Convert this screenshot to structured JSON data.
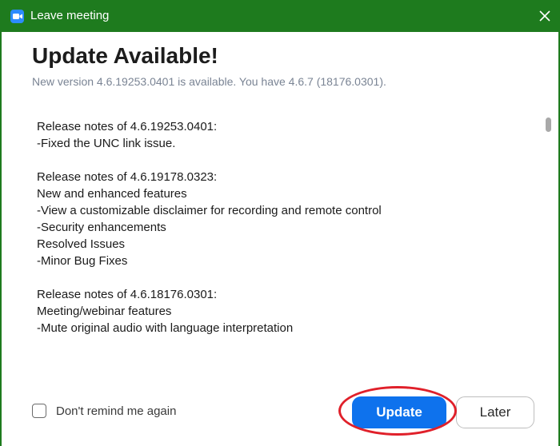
{
  "window": {
    "title": "Leave meeting",
    "title_bar_color": "#1e7b1e",
    "app_icon": "zoom-camera-icon",
    "close_icon": "close-icon"
  },
  "dialog": {
    "heading": "Update Available!",
    "version_info": "New version 4.6.19253.0401 is available. You have 4.6.7 (18176.0301)."
  },
  "release_notes": [
    "Release notes of 4.6.19253.0401:",
    "-Fixed the UNC link issue.",
    "",
    "Release notes of 4.6.19178.0323:",
    "New and enhanced features",
    "-View a customizable disclaimer for recording and remote control",
    "-Security enhancements",
    "Resolved Issues",
    "-Minor Bug Fixes",
    "",
    "Release notes of 4.6.18176.0301:",
    "Meeting/webinar features",
    "-Mute original audio with language interpretation"
  ],
  "footer": {
    "remind_label": "Don't remind me again",
    "remind_checked": false,
    "update_label": "Update",
    "later_label": "Later",
    "update_color": "#0e72ed",
    "highlight_color": "#e0202a"
  }
}
